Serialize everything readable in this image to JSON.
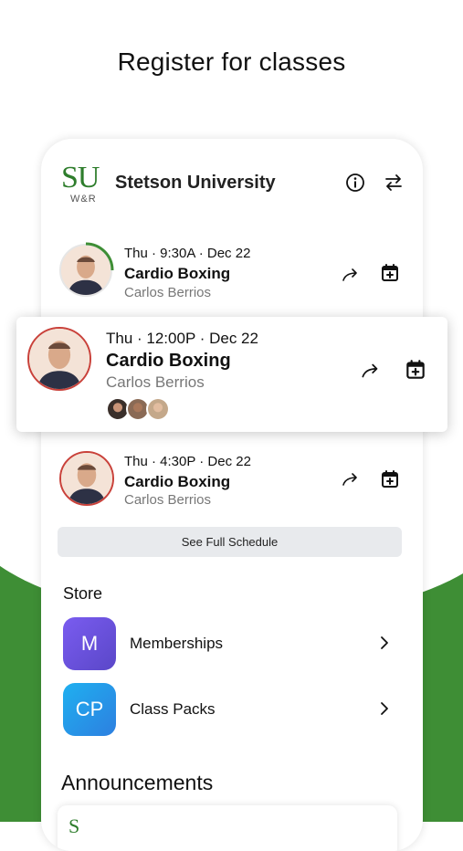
{
  "headline": "Register for classes",
  "header": {
    "logo_text": "SU",
    "logo_sub": "W&R",
    "school_name": "Stetson University"
  },
  "classes": [
    {
      "time": "Thu · 9:30A · Dec 22",
      "title": "Cardio Boxing",
      "instructor": "Carlos Berrios"
    },
    {
      "time": "Thu · 12:00P · Dec 22",
      "title": "Cardio Boxing",
      "instructor": "Carlos Berrios"
    },
    {
      "time": "Thu · 4:30P · Dec 22",
      "title": "Cardio Boxing",
      "instructor": "Carlos Berrios"
    }
  ],
  "see_full_schedule": "See Full Schedule",
  "store": {
    "title": "Store",
    "items": [
      {
        "icon_text": "M",
        "label": "Memberships",
        "color": "#6b4fd8"
      },
      {
        "icon_text": "CP",
        "label": "Class Packs",
        "color": "#1a9ce8"
      }
    ]
  },
  "announcements": {
    "title": "Announcements",
    "logo_text": "S"
  },
  "colors": {
    "brand_green": "#3e8e35",
    "avatar_ring": "#c9413a"
  }
}
